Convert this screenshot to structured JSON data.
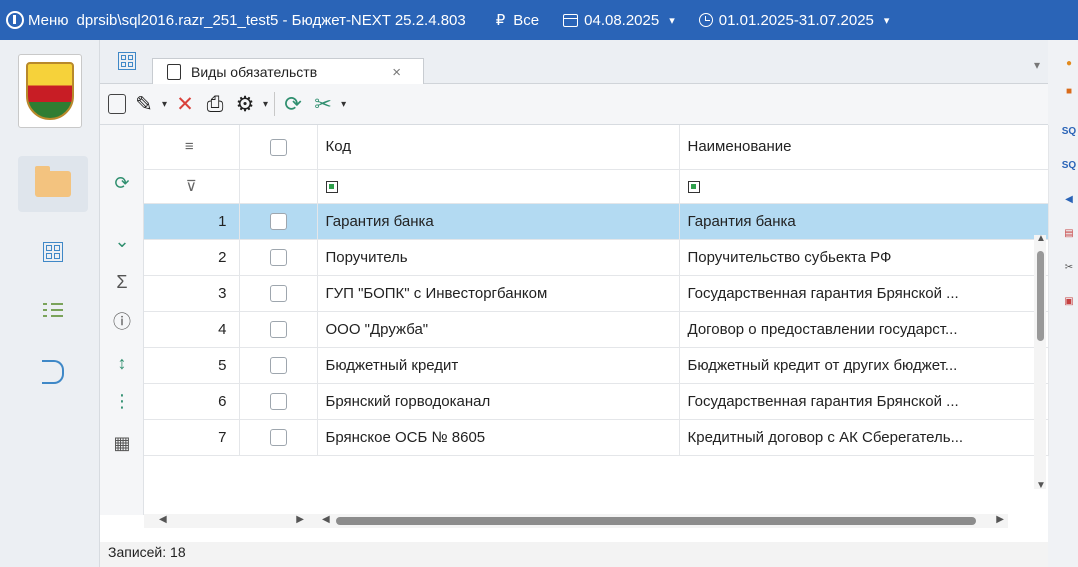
{
  "titlebar": {
    "menu": "Меню",
    "title": "dprsib\\sql2016.razr_251_test5 - Бюджет-NEXT 25.2.4.803",
    "currency": "₽",
    "scope": "Все",
    "date": "04.08.2025",
    "period": "01.01.2025-31.07.2025",
    "accent": "#2A64B7"
  },
  "tab": {
    "label": "Виды обязательств",
    "close": "×"
  },
  "table": {
    "headers": [
      "",
      "",
      "Код",
      "Наименование"
    ],
    "filter_icon": "filter-off-icon",
    "rows": [
      {
        "n": "1",
        "code": "Гарантия банка",
        "name": "Гарантия банка",
        "selected": true
      },
      {
        "n": "2",
        "code": "Поручитель",
        "name": "Поручительство субьекта РФ"
      },
      {
        "n": "3",
        "code": "ГУП \"БОПК\" с Инвесторгбанком",
        "name": "Государственная гарантия Брянской ..."
      },
      {
        "n": "4",
        "code": "ООО \"Дружба\"",
        "name": "Договор о предоставлении государст..."
      },
      {
        "n": "5",
        "code": "Бюджетный кредит",
        "name": "Бюджетный кредит от других бюджет..."
      },
      {
        "n": "6",
        "code": "Брянский горводоканал",
        "name": "Государственная гарантия Брянской ..."
      },
      {
        "n": "7",
        "code": "Брянское ОСБ № 8605",
        "name": "Кредитный договор с АК Сберегатель..."
      }
    ]
  },
  "status": {
    "records": "Записей: 18"
  }
}
